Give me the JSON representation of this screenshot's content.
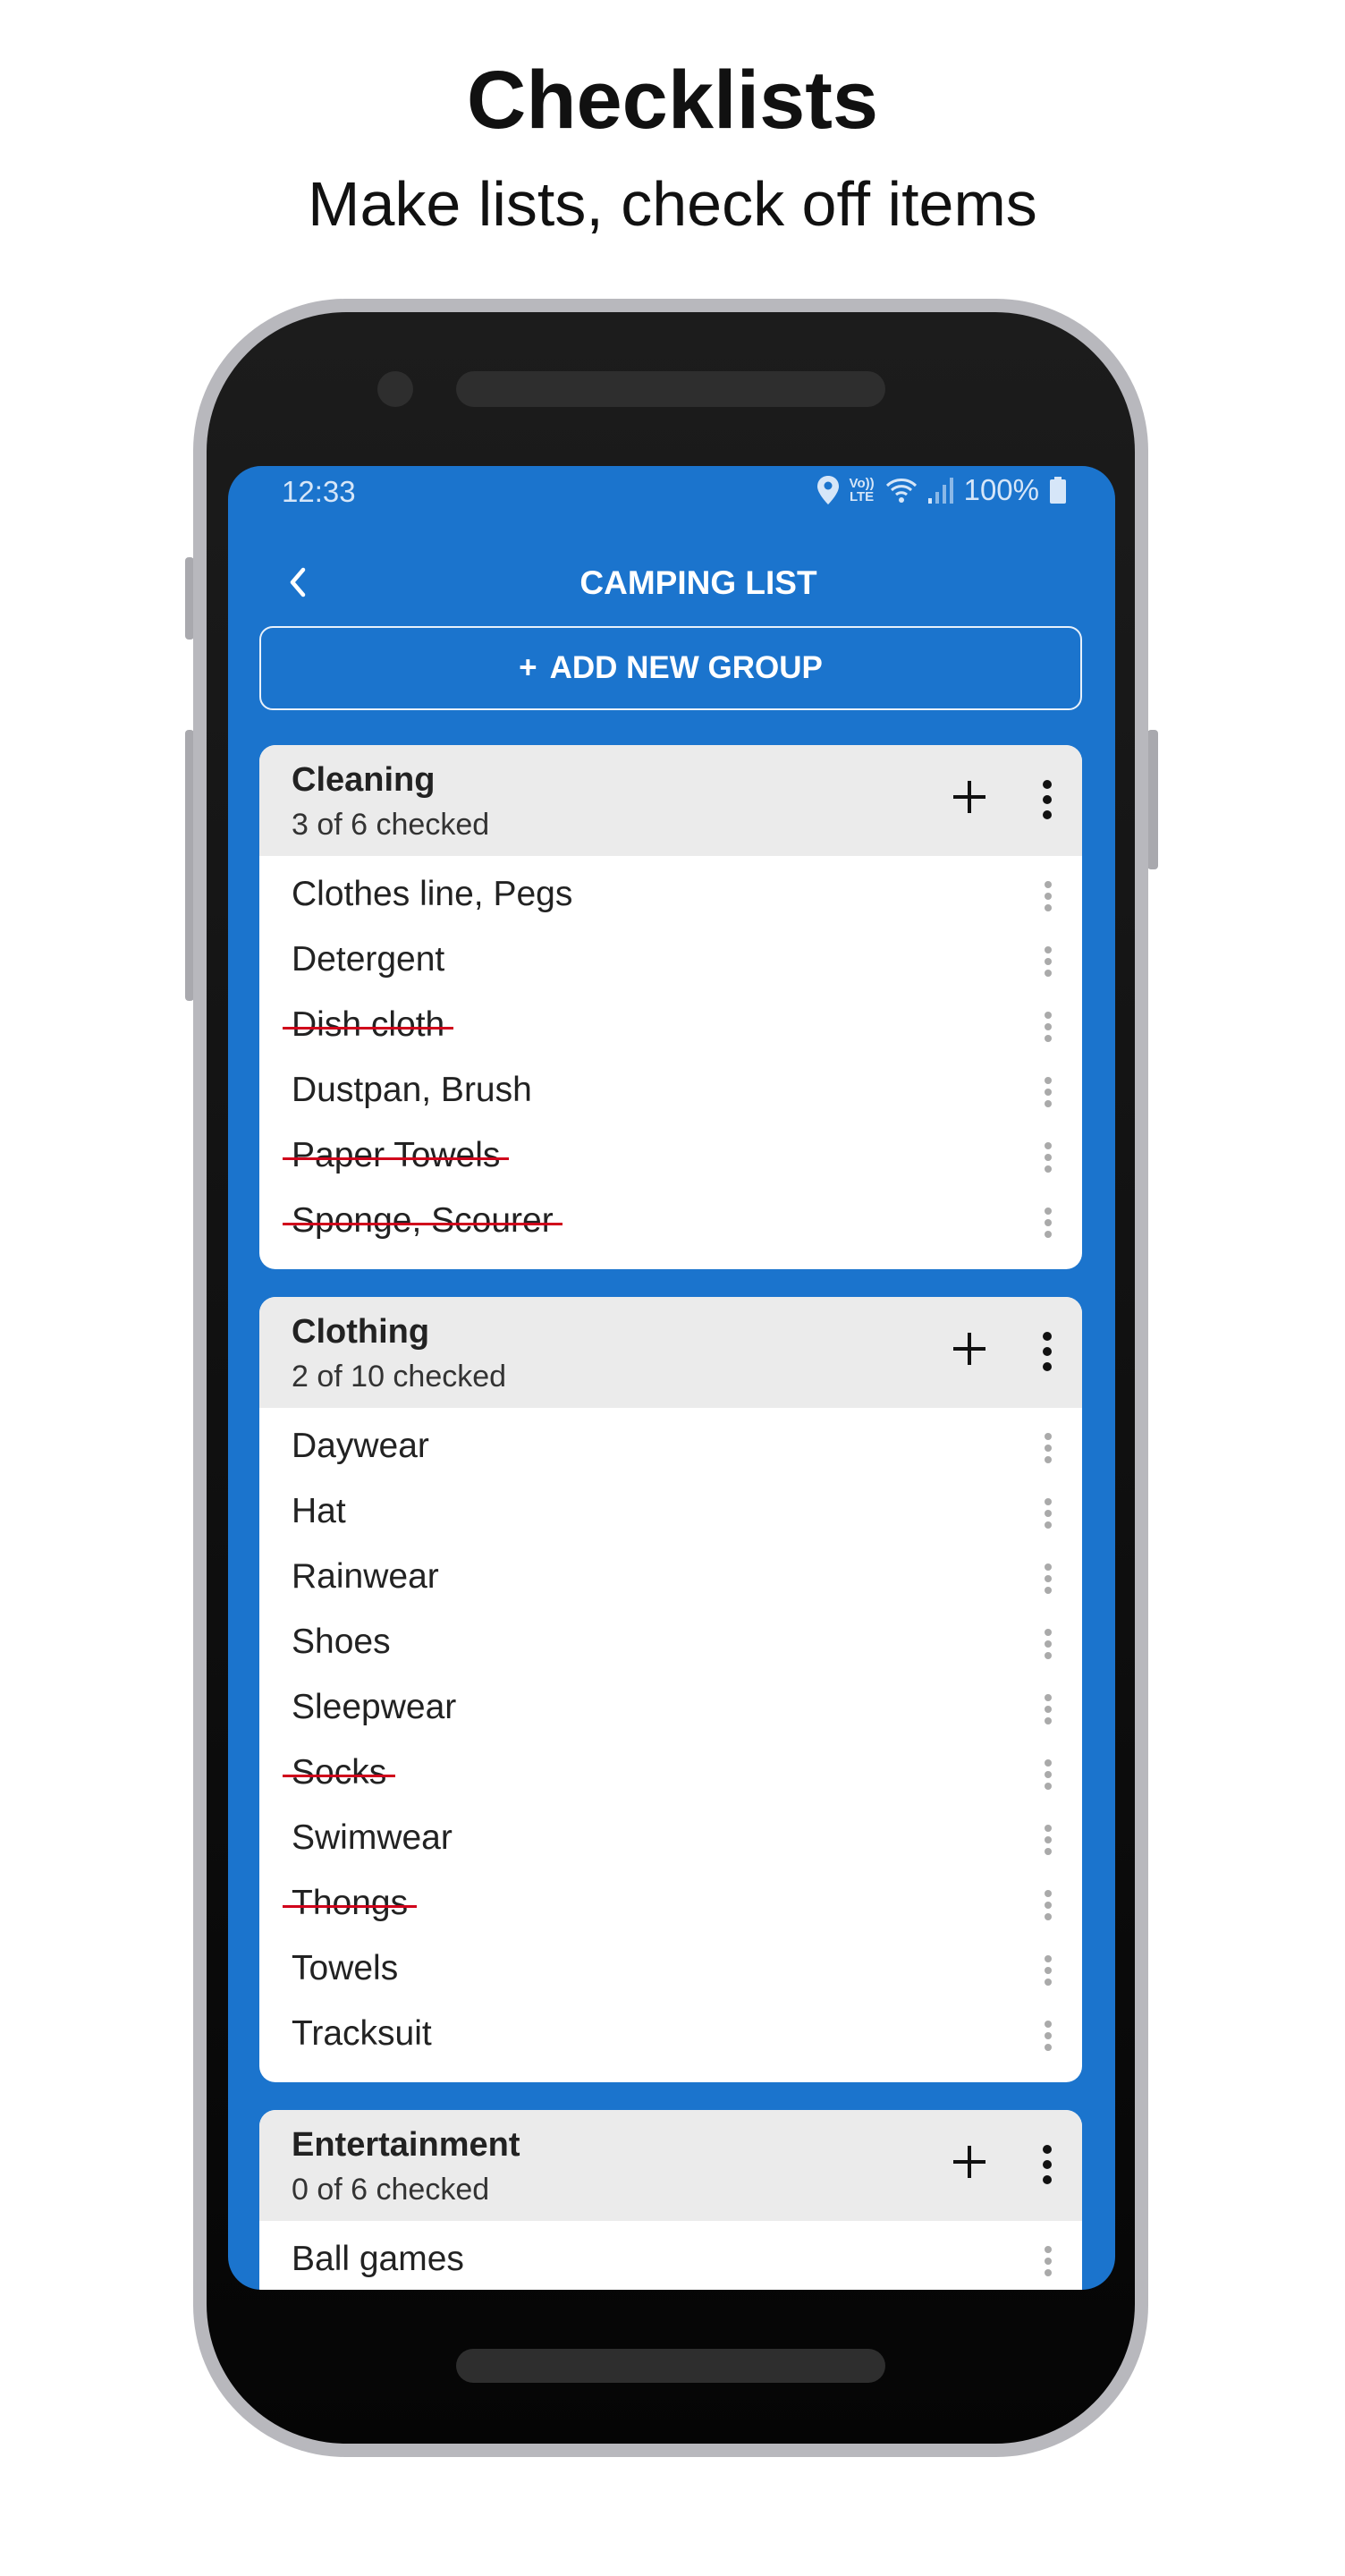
{
  "hero": {
    "title": "Checklists",
    "subtitle": "Make lists, check off items"
  },
  "status_bar": {
    "time": "12:33",
    "network": "VoLTE",
    "lte_top": "Vo))",
    "lte_bottom": "LTE",
    "battery": "100%",
    "icons": [
      "location-icon",
      "volte-icon",
      "wifi-icon",
      "signal-icon",
      "battery-icon"
    ]
  },
  "app_bar": {
    "title": "CAMPING LIST",
    "back_icon": "chevron-left-icon"
  },
  "add_group": {
    "icon": "+",
    "label": "ADD NEW GROUP"
  },
  "colors": {
    "primary": "#1b74cd",
    "group_header": "#ebebeb",
    "strike": "#d0021b"
  },
  "groups": [
    {
      "title": "Cleaning",
      "summary": "3 of 6 checked",
      "items": [
        {
          "label": "Clothes line, Pegs",
          "checked": false
        },
        {
          "label": "Detergent",
          "checked": false
        },
        {
          "label": "Dish cloth",
          "checked": true
        },
        {
          "label": "Dustpan, Brush",
          "checked": false
        },
        {
          "label": "Paper Towels",
          "checked": true
        },
        {
          "label": "Sponge, Scourer",
          "checked": true
        }
      ]
    },
    {
      "title": "Clothing",
      "summary": "2 of 10 checked",
      "items": [
        {
          "label": "Daywear",
          "checked": false
        },
        {
          "label": "Hat",
          "checked": false
        },
        {
          "label": "Rainwear",
          "checked": false
        },
        {
          "label": "Shoes",
          "checked": false
        },
        {
          "label": "Sleepwear",
          "checked": false
        },
        {
          "label": "Socks",
          "checked": true
        },
        {
          "label": "Swimwear",
          "checked": false
        },
        {
          "label": "Thongs",
          "checked": true
        },
        {
          "label": "Towels",
          "checked": false
        },
        {
          "label": "Tracksuit",
          "checked": false
        }
      ]
    },
    {
      "title": "Entertainment",
      "summary": "0 of 6 checked",
      "items": [
        {
          "label": "Ball games",
          "checked": false
        }
      ]
    }
  ]
}
